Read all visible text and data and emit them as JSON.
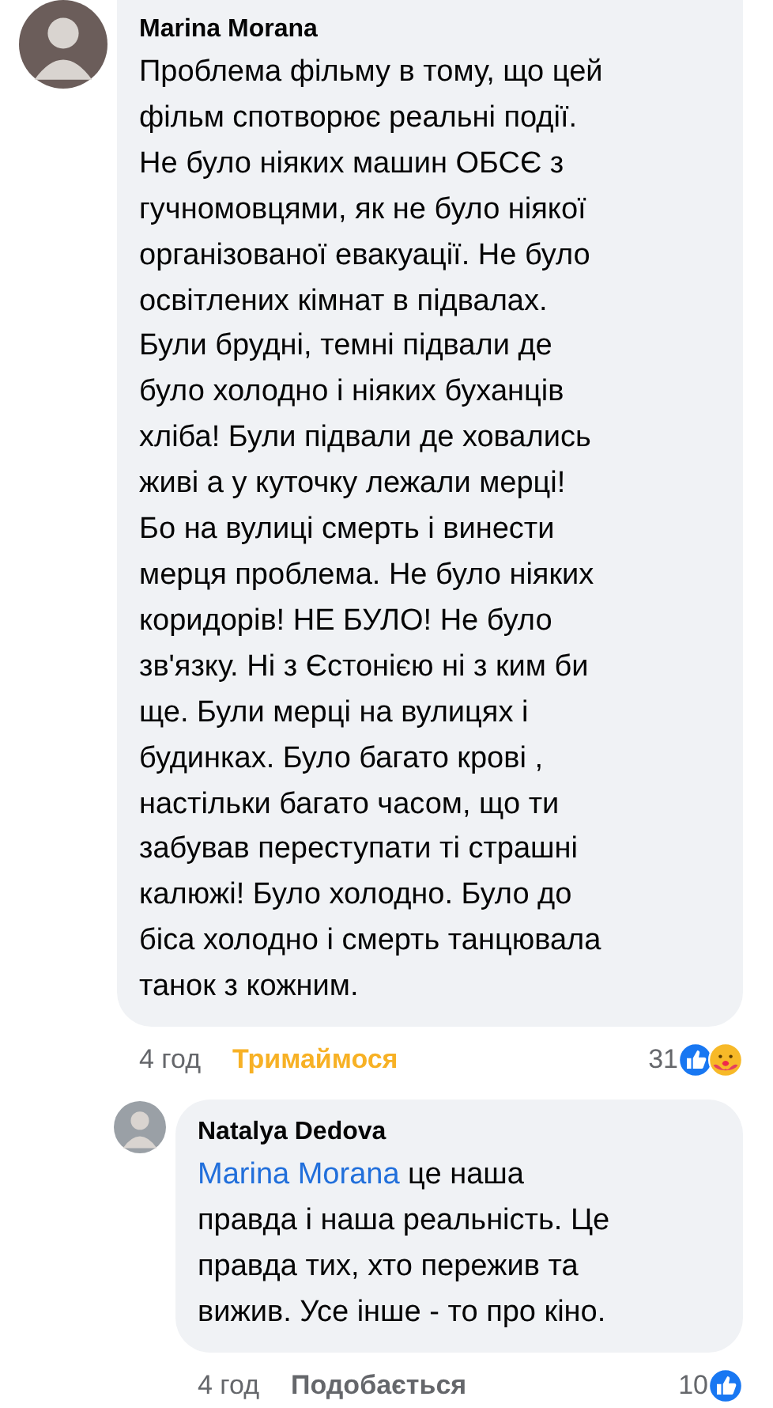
{
  "comments": [
    {
      "author": "Marina Morana",
      "reply": false,
      "text": "Проблема фільму в тому, що цей\nфільм спотворює реальні події.\nНе було ніяких машин ОБСЄ з\nгучномовцями, як не було ніякої\nорганізованої евакуації. Не було\nосвітлених кімнат в підвалах.\nБули брудні, темні підвали де\nбуло холодно і ніяких буханців\nхліба! Були підвали де ховались\nживі а у куточку лежали мерці!\nБо на вулиці смерть і винести\nмерця проблема. Не було ніяких\nкоридорів! НЕ БУЛО! Не було\nзв'язку. Ні з Єстонією ні з ким би\nще. Були мерці на вулицях і\nбудинках. Було багато крові ,\nнастільки багато часом, що ти\nзабував переступати ті страшні\nкалюжі! Було холодно. Було до\nбіса холодно і смерть танцювала\nтанок з кожним.",
      "time": "4 год",
      "action": {
        "label": "Тримаймося",
        "kind": "care"
      },
      "reaction_count": "31",
      "reactions": [
        {
          "kind": "like"
        },
        {
          "kind": "care"
        }
      ]
    },
    {
      "author": "Natalya Dedova",
      "reply": true,
      "mention": "Marina Morana",
      "text": " це наша\nправда і наша реальність. Це\nправда тих, хто пережив та\nвижив. Усе інше - то про кіно.",
      "time": "4 год",
      "action": {
        "label": "Подобається",
        "kind": "none"
      },
      "reaction_count": "10",
      "reactions": [
        {
          "kind": "like"
        }
      ]
    }
  ]
}
